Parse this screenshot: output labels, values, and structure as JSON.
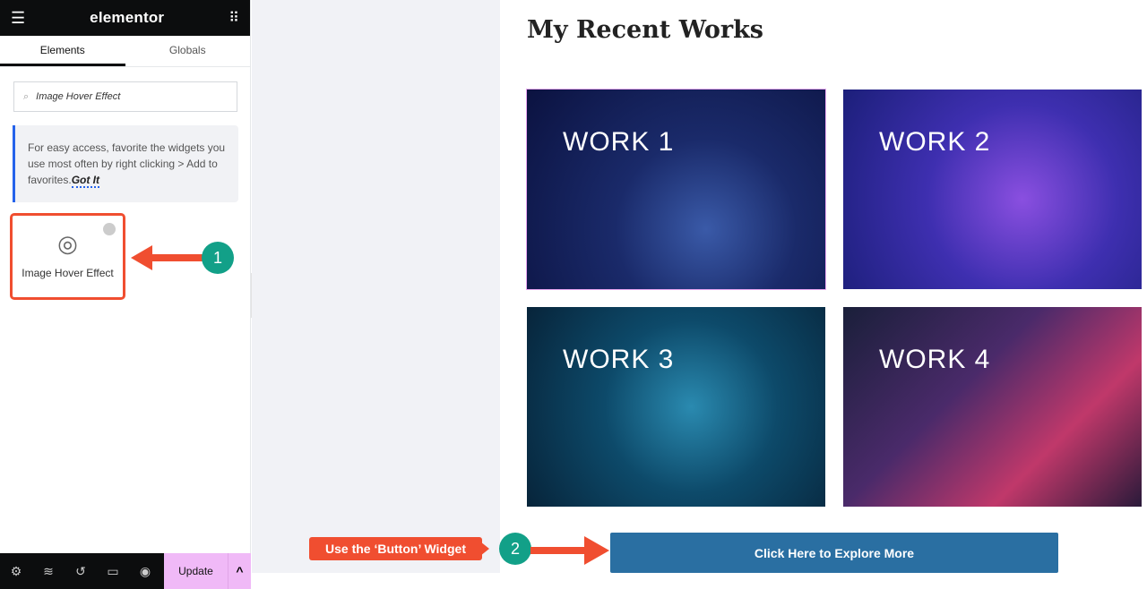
{
  "sidebar": {
    "logo": "elementor",
    "tabs": [
      "Elements",
      "Globals"
    ],
    "search_value": "Image Hover Effect",
    "note_text": "For easy access, favorite the widgets you use most often by right clicking > Add to favorites.",
    "note_link": "Got It",
    "widget_label": "Image Hover Effect",
    "update_label": "Update"
  },
  "page": {
    "title": "My Recent Works",
    "works": [
      "WORK 1",
      "WORK 2",
      "WORK 3",
      "WORK 4"
    ],
    "button_label": "Click Here to Explore More"
  },
  "annotations": {
    "badge1": "1",
    "badge2": "2",
    "callout": "Use the ‘Button’ Widget",
    "arrow_color": "#f04e30",
    "badge_color": "#12a088"
  }
}
